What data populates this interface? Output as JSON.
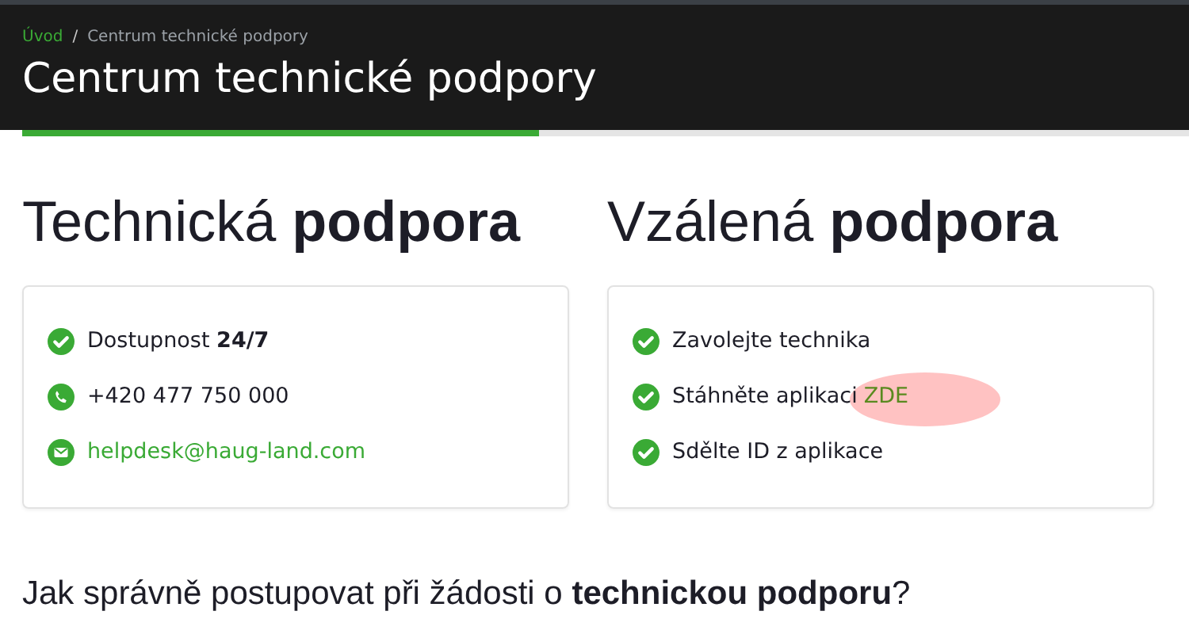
{
  "breadcrumb": [
    {
      "label": "Úvod",
      "kind": "link"
    },
    {
      "label": "Centrum technické podpory",
      "kind": "current"
    }
  ],
  "breadcrumb_separator": "/",
  "page_title": "Centrum technické podpory",
  "sections": [
    {
      "heading": "Technická **podpora**",
      "items": [
        {
          "kind": "check",
          "text": "Dostupnost **24/7**"
        },
        {
          "kind": "phone",
          "text": "+420 477 750 000"
        },
        {
          "kind": "mail",
          "link": "helpdesk@haug-land.com"
        }
      ]
    },
    {
      "heading": "Vzálená **podpora**",
      "items": [
        {
          "kind": "check",
          "text": "Zavolejte technika"
        },
        {
          "kind": "check",
          "text": "Stáhněte aplikaci",
          "link": "ZDE",
          "highlighted": true
        },
        {
          "kind": "check",
          "text": "Sdělte ID z aplikace"
        }
      ]
    }
  ],
  "question": "Jak správně postupovat při žádosti o **technickou podporu**?"
}
